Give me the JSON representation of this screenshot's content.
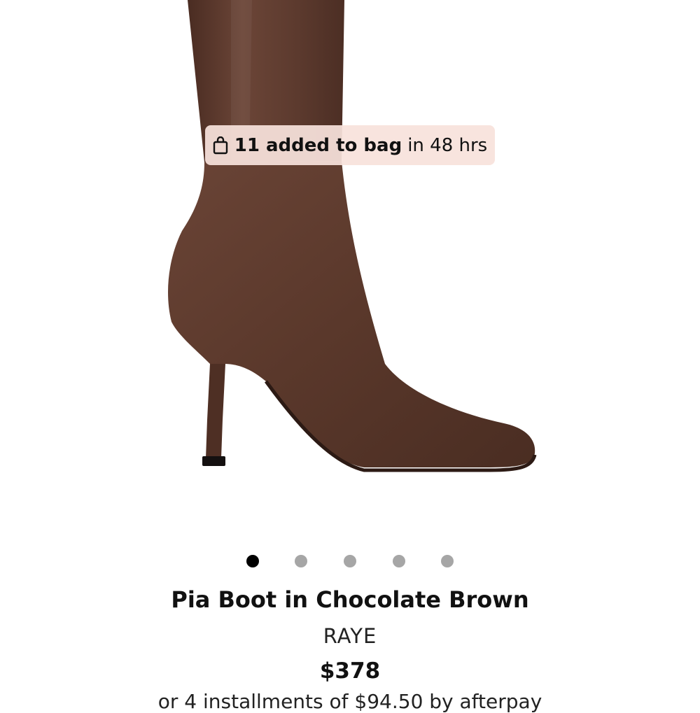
{
  "product": {
    "image_alt": "Pia Boot in Chocolate Brown",
    "social_proof": {
      "count_text": "11 added to bag",
      "time_text": "in 48 hrs",
      "icon": "shopping-bag-icon"
    },
    "carousel": {
      "total": 5,
      "active_index": 0
    },
    "title": "Pia Boot in Chocolate Brown",
    "brand": "RAYE",
    "price": "$378",
    "installments_text": "or 4 installments of $94.50 by afterpay",
    "colors": {
      "leather": "#5c3a2e",
      "badge_bg": "#f8e2dc"
    }
  }
}
